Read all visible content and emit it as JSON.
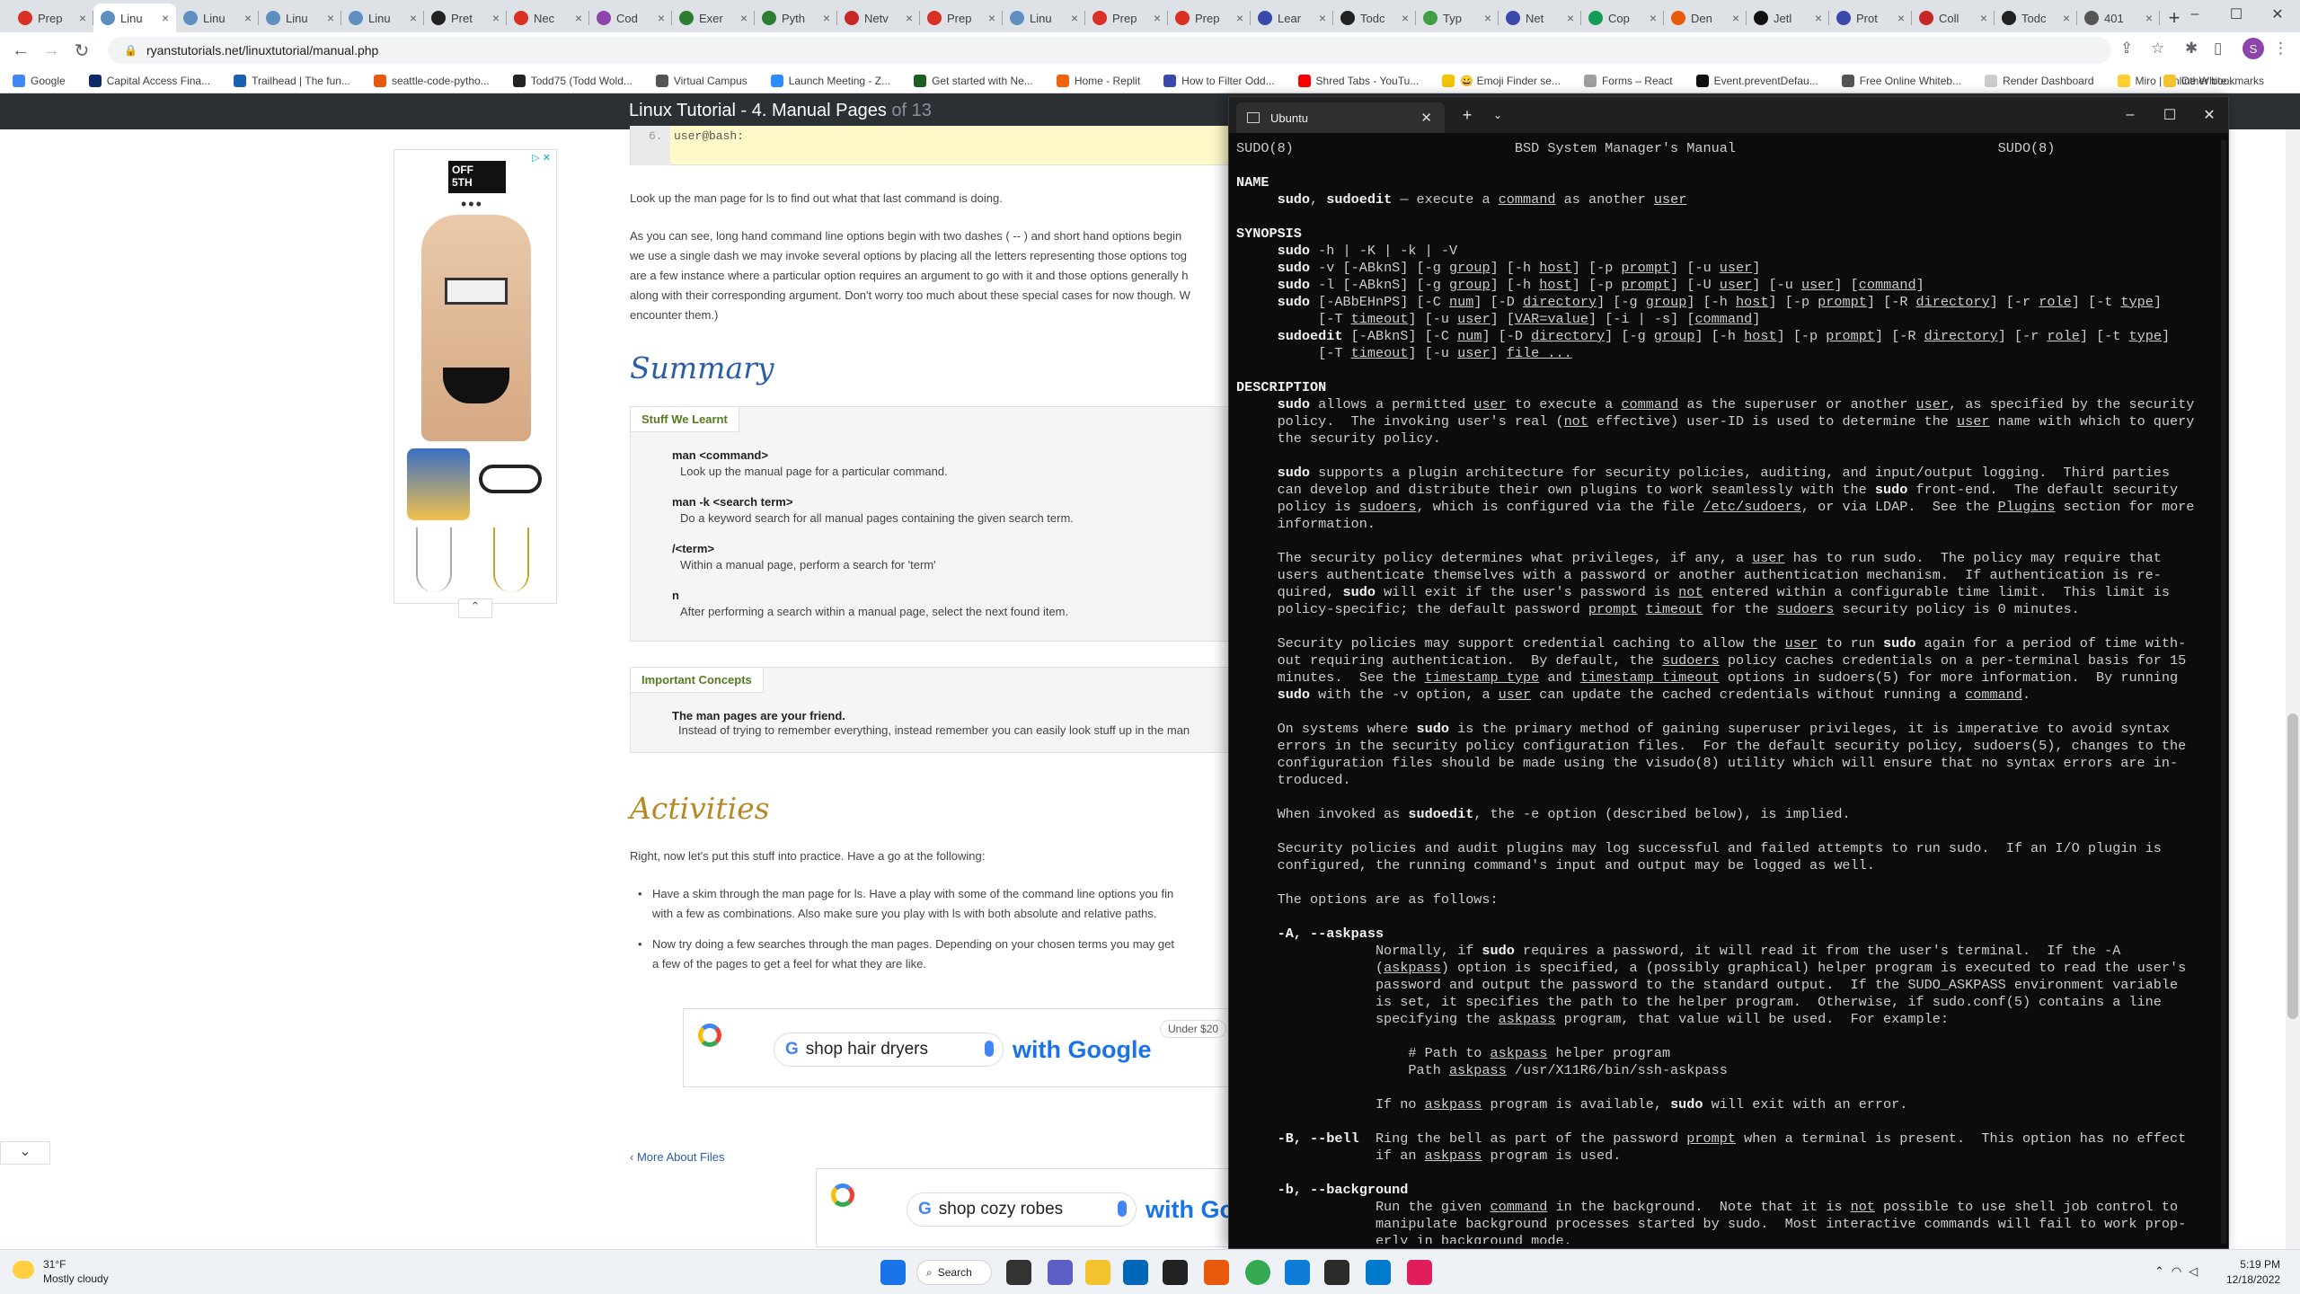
{
  "browser": {
    "tabs": [
      {
        "label": "Prep",
        "color": "#d93025"
      },
      {
        "label": "Linu",
        "color": "#5f8fbf",
        "active": true
      },
      {
        "label": "Linu",
        "color": "#5f8fbf"
      },
      {
        "label": "Linu",
        "color": "#5f8fbf"
      },
      {
        "label": "Linu",
        "color": "#5f8fbf"
      },
      {
        "label": "Pret",
        "color": "#222222"
      },
      {
        "label": "Nec",
        "color": "#d93025"
      },
      {
        "label": "Cod",
        "color": "#8e44ad"
      },
      {
        "label": "Exer",
        "color": "#2e7d32"
      },
      {
        "label": "Pyth",
        "color": "#2e7d32"
      },
      {
        "label": "Netv",
        "color": "#c62828"
      },
      {
        "label": "Prep",
        "color": "#d93025"
      },
      {
        "label": "Linu",
        "color": "#5f8fbf"
      },
      {
        "label": "Prep",
        "color": "#d93025"
      },
      {
        "label": "Prep",
        "color": "#d93025"
      },
      {
        "label": "Lear",
        "color": "#3949ab"
      },
      {
        "label": "Todc",
        "color": "#222222"
      },
      {
        "label": "Typ",
        "color": "#43a047"
      },
      {
        "label": "Net",
        "color": "#3949ab"
      },
      {
        "label": "Cop",
        "color": "#0f9d58"
      },
      {
        "label": "Den",
        "color": "#e8590c"
      },
      {
        "label": "Jetl",
        "color": "#111111"
      },
      {
        "label": "Prot",
        "color": "#3949ab"
      },
      {
        "label": "Coll",
        "color": "#c62828"
      },
      {
        "label": "Todc",
        "color": "#222222"
      },
      {
        "label": "401",
        "color": "#555555"
      }
    ],
    "tab_close_glyph": "×",
    "new_tab_glyph": "+",
    "url": "ryanstutorials.net/linuxtutorial/manual.php",
    "profile_initial": "S",
    "bookmarks": [
      {
        "label": "Google",
        "color": "#4285f4"
      },
      {
        "label": "Capital Access Fina...",
        "color": "#0d2a6b"
      },
      {
        "label": "Trailhead | The fun...",
        "color": "#1a5fb4"
      },
      {
        "label": "seattle-code-pytho...",
        "color": "#e8590c"
      },
      {
        "label": "Todd75 (Todd Wold...",
        "color": "#222222"
      },
      {
        "label": "Virtual Campus",
        "color": "#555555"
      },
      {
        "label": "Launch Meeting - Z...",
        "color": "#2d8cff"
      },
      {
        "label": "Get started with Ne...",
        "color": "#1b5e20"
      },
      {
        "label": "Home - Replit",
        "color": "#f26207"
      },
      {
        "label": "How to Filter Odd...",
        "color": "#3949ab"
      },
      {
        "label": "Shred Tabs - YouTu...",
        "color": "#ff0000"
      },
      {
        "label": "😀 Emoji Finder se...",
        "color": "#f5c400"
      },
      {
        "label": "Forms – React",
        "color": "#9e9e9e"
      },
      {
        "label": "Event.preventDefau...",
        "color": "#111111"
      },
      {
        "label": "Free Online Whiteb...",
        "color": "#555555"
      },
      {
        "label": "Render Dashboard",
        "color": "#cccccc"
      },
      {
        "label": "Miro | Online White...",
        "color": "#ffd02f"
      }
    ],
    "other_bookmarks": "Other bookmarks"
  },
  "page": {
    "site_title": "Linux Tutorial - 4. Manual Pages",
    "site_title_of": "of 13",
    "code": {
      "line_no": "6.",
      "text": "user@bash:"
    },
    "para1": "Look up the man page for ls to find out what that last command is doing.",
    "para2_lines": [
      "As you can see, long hand command line options begin with two dashes ( -- ) and short hand options begin",
      "we use a single dash we may invoke several options by placing all the letters representing those options tog",
      "are a few instance where a particular option requires an argument to go with it and those options generally h",
      "along with their corresponding argument. Don't worry too much about these special cases for now though. W",
      "encounter them.)"
    ],
    "summary_heading": "Summary",
    "stuff_tab": "Stuff We Learnt",
    "stuff_items": [
      {
        "term": "man <command>",
        "def": "Look up the manual page for a particular command."
      },
      {
        "term": "man -k <search term>",
        "def": "Do a keyword search for all manual pages containing the given search term."
      },
      {
        "term": "/<term>",
        "def": "Within a manual page, perform a search for 'term'"
      },
      {
        "term": "n",
        "def": "After performing a search within a manual page, select the next found item."
      }
    ],
    "concepts_tab": "Important Concepts",
    "concept_term": "The man pages are your friend.",
    "concept_def": "Instead of trying to remember everything, instead remember you can easily look stuff up in the man",
    "activities_heading": "Activities",
    "activities_intro": "Right, now let's put this stuff into practice. Have a go at the following:",
    "bullets": [
      [
        "Have a skim through the man page for ls. Have a play with some of the command line options you fin",
        "with a few as combinations. Also make sure you play with ls with both absolute and relative paths."
      ],
      [
        "Now try doing a few searches through the man pages. Depending on your chosen terms you may get",
        "a few of the pages to get a feel for what they are like."
      ]
    ],
    "more_link": "More About Files",
    "ad": {
      "brand_line1": "OFF",
      "brand_line2": "5TH",
      "adchoice": "▷ ✕",
      "dots": "•••"
    },
    "gad1": {
      "query": "shop hair dryers",
      "tagline": "with Google",
      "price": "Under $20"
    },
    "gad2": {
      "query": "shop cozy robes",
      "tagline": "with Go"
    }
  },
  "terminal": {
    "tab_title": "Ubuntu",
    "lines": [
      "SUDO(8)                           BSD System Manager's Manual                                SUDO(8)",
      "",
      "NAME",
      "     sudo, sudoedit — execute a command as another user",
      "",
      "SYNOPSIS",
      "     sudo -h | -K | -k | -V",
      "     sudo -v [-ABknS] [-g group] [-h host] [-p prompt] [-u user]",
      "     sudo -l [-ABknS] [-g group] [-h host] [-p prompt] [-U user] [-u user] [command]",
      "     sudo [-ABbEHnPS] [-C num] [-D directory] [-g group] [-h host] [-p prompt] [-R directory] [-r role] [-t type]",
      "          [-T timeout] [-u user] [VAR=value] [-i | -s] [command]",
      "     sudoedit [-ABknS] [-C num] [-D directory] [-g group] [-h host] [-p prompt] [-R directory] [-r role] [-t type]",
      "          [-T timeout] [-u user] file ...",
      "",
      "DESCRIPTION",
      "     sudo allows a permitted user to execute a command as the superuser or another user, as specified by the security",
      "     policy.  The invoking user's real (not effective) user-ID is used to determine the user name with which to query",
      "     the security policy.",
      "",
      "     sudo supports a plugin architecture for security policies, auditing, and input/output logging.  Third parties",
      "     can develop and distribute their own plugins to work seamlessly with the sudo front-end.  The default security",
      "     policy is sudoers, which is configured via the file /etc/sudoers, or via LDAP.  See the Plugins section for more",
      "     information.",
      "",
      "     The security policy determines what privileges, if any, a user has to run sudo.  The policy may require that",
      "     users authenticate themselves with a password or another authentication mechanism.  If authentication is re-",
      "     quired, sudo will exit if the user's password is not entered within a configurable time limit.  This limit is",
      "     policy-specific; the default password prompt timeout for the sudoers security policy is 0 minutes.",
      "",
      "     Security policies may support credential caching to allow the user to run sudo again for a period of time with-",
      "     out requiring authentication.  By default, the sudoers policy caches credentials on a per-terminal basis for 15",
      "     minutes.  See the timestamp_type and timestamp_timeout options in sudoers(5) for more information.  By running",
      "     sudo with the -v option, a user can update the cached credentials without running a command.",
      "",
      "     On systems where sudo is the primary method of gaining superuser privileges, it is imperative to avoid syntax",
      "     errors in the security policy configuration files.  For the default security policy, sudoers(5), changes to the",
      "     configuration files should be made using the visudo(8) utility which will ensure that no syntax errors are in-",
      "     troduced.",
      "",
      "     When invoked as sudoedit, the -e option (described below), is implied.",
      "",
      "     Security policies and audit plugins may log successful and failed attempts to run sudo.  If an I/O plugin is",
      "     configured, the running command's input and output may be logged as well.",
      "",
      "     The options are as follows:",
      "",
      "     -A, --askpass",
      "                 Normally, if sudo requires a password, it will read it from the user's terminal.  If the -A",
      "                 (askpass) option is specified, a (possibly graphical) helper program is executed to read the user's",
      "                 password and output the password to the standard output.  If the SUDO_ASKPASS environment variable",
      "                 is set, it specifies the path to the helper program.  Otherwise, if sudo.conf(5) contains a line",
      "                 specifying the askpass program, that value will be used.  For example:",
      "",
      "                     # Path to askpass helper program",
      "                     Path askpass /usr/X11R6/bin/ssh-askpass",
      "",
      "                 If no askpass program is available, sudo will exit with an error.",
      "",
      "     -B, --bell  Ring the bell as part of the password prompt when a terminal is present.  This option has no effect",
      "                 if an askpass program is used.",
      "",
      "     -b, --background",
      "                 Run the given command in the background.  Note that it is not possible to use shell job control to",
      "                 manipulate background processes started by sudo.  Most interactive commands will fail to work prop-",
      "                 erly in background mode."
    ]
  },
  "taskbar": {
    "weather_temp": "31°F",
    "weather_desc": "Mostly cloudy",
    "search_label": "Search",
    "time": "5:19 PM",
    "date": "12/18/2022",
    "apps": [
      {
        "name": "start-icon",
        "color": "#1a73e8"
      },
      {
        "name": "task-view-icon",
        "color": "#333333"
      },
      {
        "name": "chat-icon",
        "color": "#5b5fc7"
      },
      {
        "name": "file-explorer-icon",
        "color": "#f4c430"
      },
      {
        "name": "store-icon",
        "color": "#0067b8"
      },
      {
        "name": "app-icon",
        "color": "#222222"
      },
      {
        "name": "office-icon",
        "color": "#e8590c"
      },
      {
        "name": "chrome-icon",
        "color": "#34a853"
      },
      {
        "name": "edge-icon",
        "color": "#0f7bd9"
      },
      {
        "name": "terminal-icon",
        "color": "#2b2b2b"
      },
      {
        "name": "vscode-icon",
        "color": "#007acc"
      },
      {
        "name": "slack-icon",
        "color": "#e01e5a"
      }
    ]
  }
}
